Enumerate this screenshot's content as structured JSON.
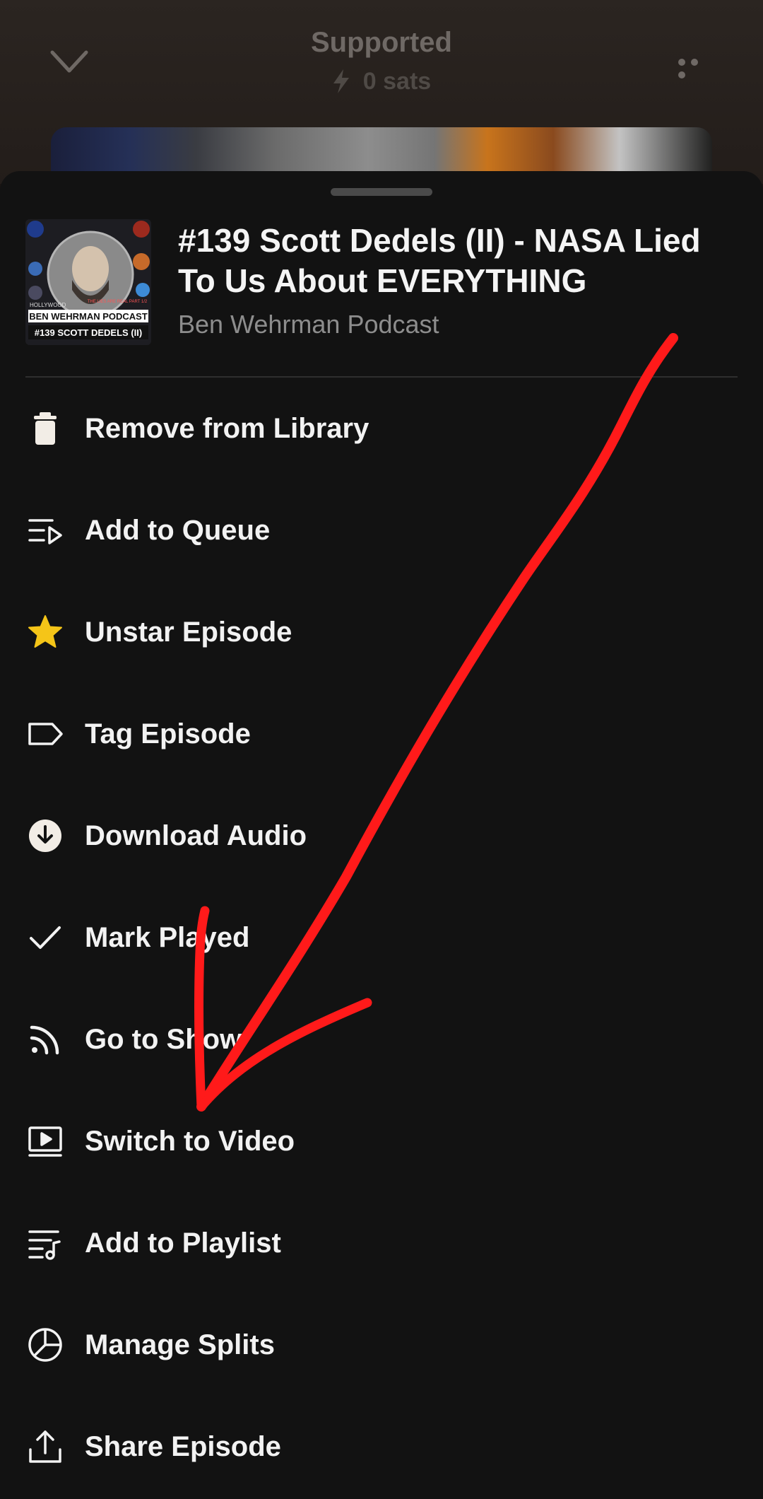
{
  "player": {
    "title": "Supported",
    "sats": "0 sats",
    "icons": [
      "chevron-down-icon",
      "bolt-icon",
      "more-icon"
    ]
  },
  "episode": {
    "title": "#139 Scott Dedels (II) - NASA Lied To Us About EVERYTHING",
    "show": "Ben Wehrman Podcast",
    "artwork_text": {
      "line1": "BEN WEHRMAN PODCAST",
      "line2": "#139 SCOTT DEDELS (II)",
      "corner": "HOLLYWOOD",
      "badge": "THE LIES ARE REAL PART 1/2"
    }
  },
  "menu": {
    "items": [
      {
        "label": "Remove from Library",
        "icon": "trash-icon"
      },
      {
        "label": "Add to Queue",
        "icon": "queue-icon"
      },
      {
        "label": "Unstar Episode",
        "icon": "star-icon"
      },
      {
        "label": "Tag Episode",
        "icon": "tag-icon"
      },
      {
        "label": "Download Audio",
        "icon": "download-icon"
      },
      {
        "label": "Mark Played",
        "icon": "check-icon"
      },
      {
        "label": "Go to Show",
        "icon": "rss-icon"
      },
      {
        "label": "Switch to Video",
        "icon": "video-icon"
      },
      {
        "label": "Add to Playlist",
        "icon": "playlist-icon"
      },
      {
        "label": "Manage Splits",
        "icon": "pie-chart-icon"
      },
      {
        "label": "Share Episode",
        "icon": "share-icon"
      }
    ]
  },
  "colors": {
    "sheet_bg": "#121212",
    "text": "#f2f2f2",
    "muted": "#8d8d8d",
    "star": "#f5c518",
    "annotation": "#ff1a1a"
  }
}
